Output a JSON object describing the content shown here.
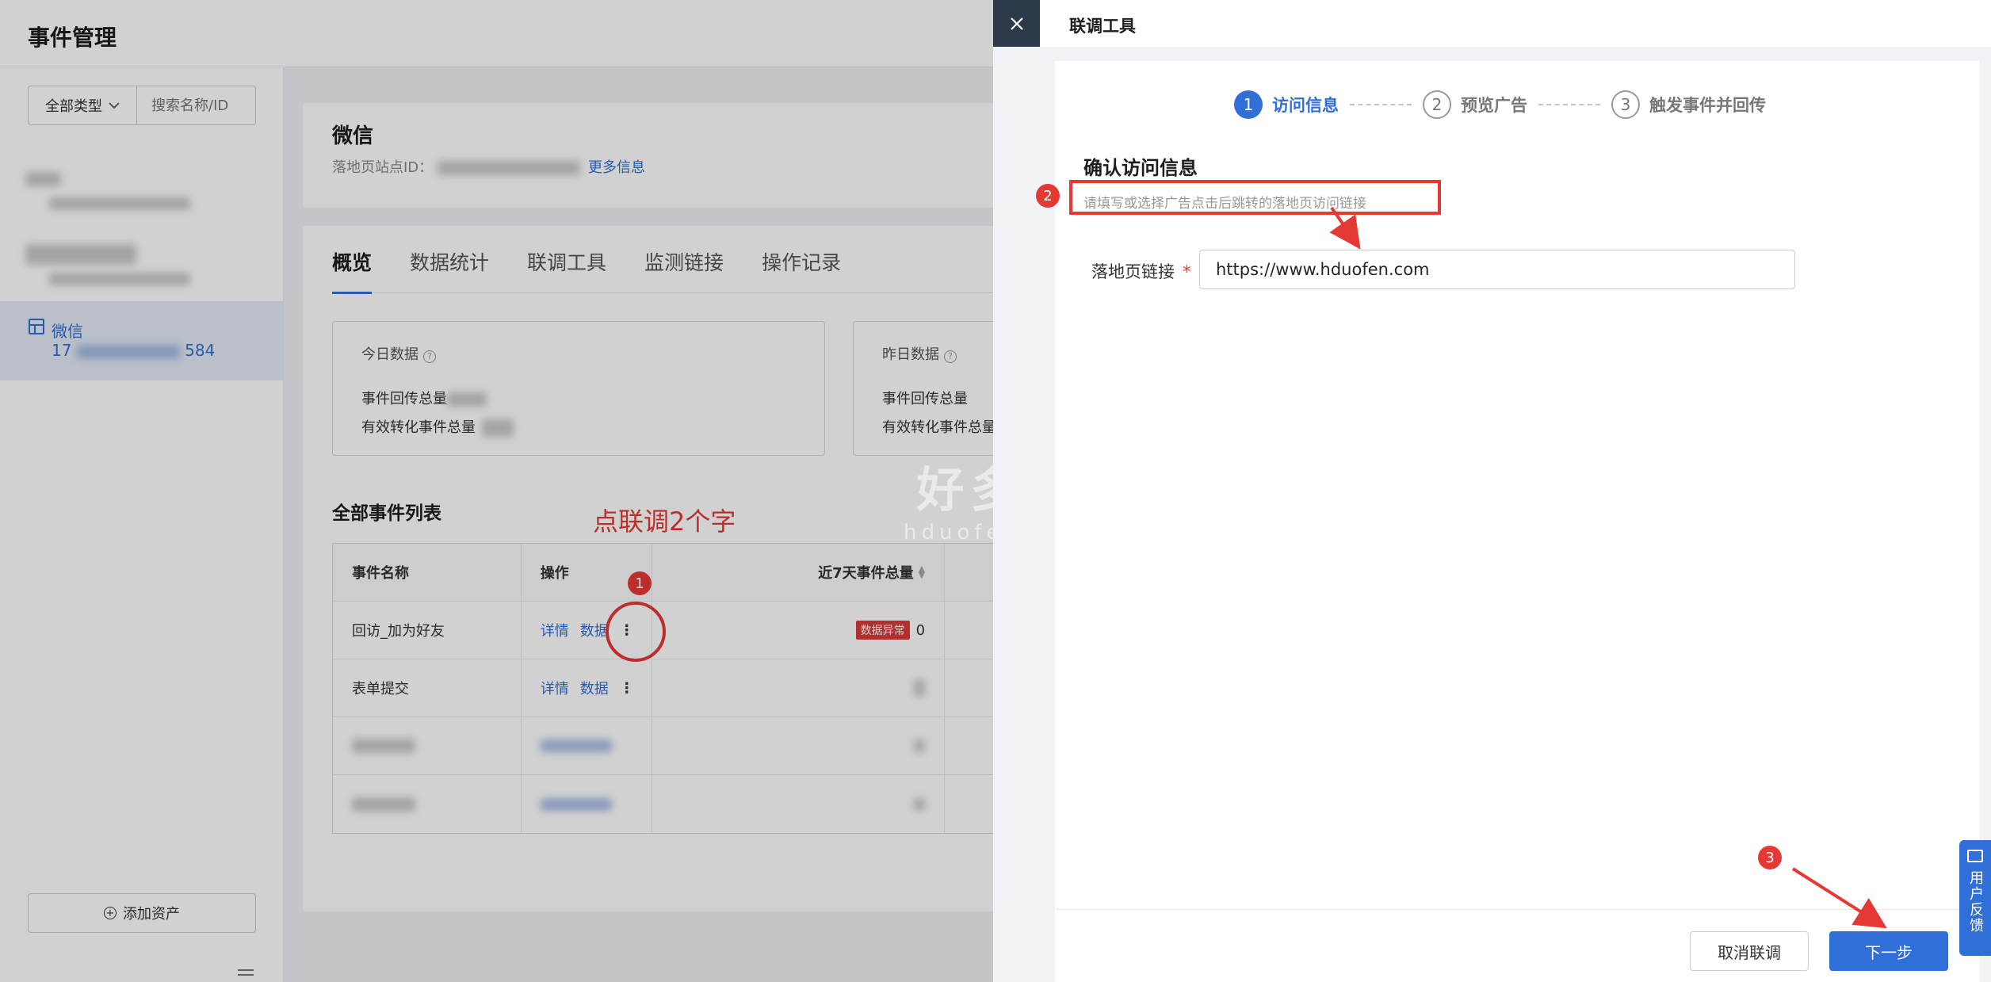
{
  "page": {
    "title": "事件管理",
    "sidebar": {
      "type_select": "全部类型",
      "search_placeholder": "搜索名称/ID",
      "active_asset": {
        "name": "微信",
        "id_prefix": "17",
        "id_suffix": "584"
      },
      "add_asset": "添加资产"
    },
    "info": {
      "title": "微信",
      "site_id_label": "落地页站点ID：",
      "more": "更多信息"
    },
    "tabs": [
      "概览",
      "数据统计",
      "联调工具",
      "监测链接",
      "操作记录"
    ],
    "today": {
      "title": "今日数据",
      "line1": "事件回传总量",
      "line2": "有效转化事件总量"
    },
    "yesterday": {
      "title": "昨日数据",
      "line1": "事件回传总量",
      "line2": "有效转化事件总量"
    },
    "events": {
      "title": "全部事件列表",
      "headers": {
        "name": "事件名称",
        "ops": "操作",
        "total": "近7天事件总量"
      },
      "rows": [
        {
          "name": "回访_加为好友",
          "detail": "详情",
          "data": "数据",
          "more": "⋮",
          "badge": "数据异常",
          "count": "0"
        },
        {
          "name": "表单提交",
          "detail": "详情",
          "data": "数据",
          "more": "⋮"
        }
      ]
    }
  },
  "annotations": {
    "note": "点联调2个字",
    "badge1": "1",
    "badge2": "2",
    "badge3": "3",
    "color": "#e53935"
  },
  "drawer": {
    "title": "联调工具",
    "close_icon": "close-icon",
    "steps": [
      {
        "num": "1",
        "label": "访问信息"
      },
      {
        "num": "2",
        "label": "预览广告"
      },
      {
        "num": "3",
        "label": "触发事件并回传"
      }
    ],
    "section_title": "确认访问信息",
    "hint": "请填写或选择广告点击后跳转的落地页访问链接",
    "form": {
      "label": "落地页链接",
      "required": "*",
      "value": "https://www.hduofen.com"
    },
    "cancel": "取消联调",
    "next": "下一步"
  },
  "feedback": "用户反馈",
  "watermark": {
    "main": "好多粉",
    "sub": "hduofen.com"
  },
  "colors": {
    "primary": "#2f6fd7",
    "danger": "#d93a3a",
    "drawer_close_bg": "#2c3949"
  }
}
